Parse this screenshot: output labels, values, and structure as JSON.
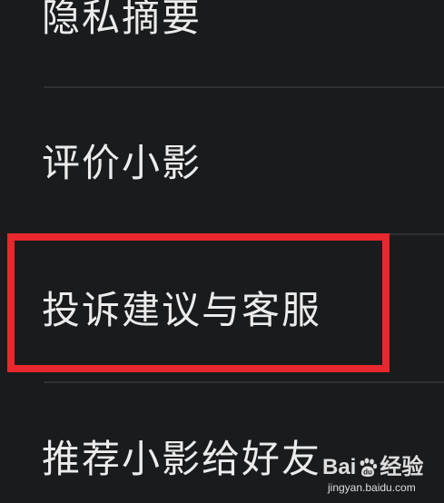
{
  "menu": {
    "items": [
      {
        "label": "隐私摘要"
      },
      {
        "label": "评价小影"
      },
      {
        "label": "投诉建议与客服"
      },
      {
        "label": "推荐小影给好友"
      }
    ]
  },
  "highlight": {
    "color": "#e8282c"
  },
  "watermark": {
    "brand_left": "Bai",
    "brand_right": "du",
    "brand_suffix": "经验",
    "url": "jingyan.baidu.com"
  }
}
